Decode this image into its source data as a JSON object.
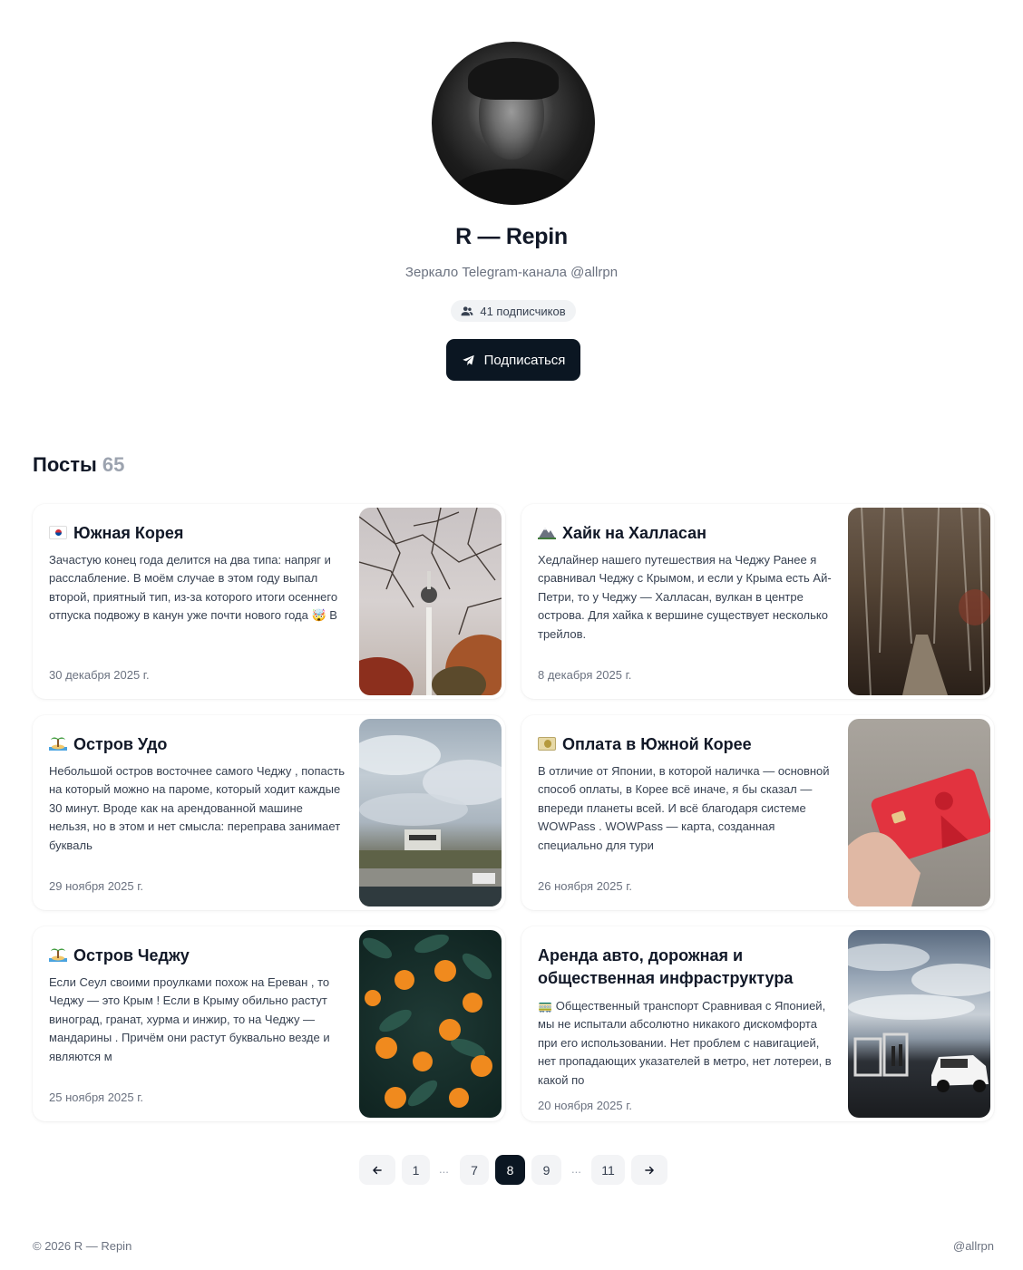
{
  "profile": {
    "name": "R — Repin",
    "subtitle": "Зеркало Telegram-канала @allrpn",
    "subscribers": "41 подписчиков",
    "subscribe_label": "Подписаться"
  },
  "posts_section": {
    "title": "Посты",
    "count": "65"
  },
  "posts": [
    {
      "title": "Южная Корея",
      "icon": "korea-flag-icon",
      "text": "Зачастую конец года делится на два типа: напряг и расслабление. В моём случае в этом году выпал второй, приятный тип, из-за которого итоги осеннего отпуска подвожу в канун уже почти нового года 🤯 В",
      "date": "30 декабря 2025 г."
    },
    {
      "title": "Хайк на Халласан",
      "icon": "mountain-icon",
      "text": "Хедлайнер нашего путешествия на Чеджу Ранее я сравнивал Чеджу с Крымом, и если у Крыма есть Ай-Петри, то у Чеджу — Халласан, вулкан в центре острова. Для хайка к вершине существует несколько трейлов.",
      "date": "8 декабря 2025 г."
    },
    {
      "title": "Остров Удо",
      "icon": "island-icon",
      "text": "Небольшой остров восточнее самого Чеджу , попасть на который можно на пароме, который ходит каждые 30 минут. Вроде как на арендованной машине нельзя, но в этом и нет смысла: переправа занимает буквaль",
      "date": "29 ноября 2025 г."
    },
    {
      "title": "Оплата в Южной Корее",
      "icon": "money-icon",
      "text": "В отличие от Японии, в которой наличка — основной способ оплаты, в Корее всё иначе, я бы сказал — впереди планеты всей. И всё благодаря системе WOWPass . WOWPass — карта, созданная специально для тури",
      "date": "26 ноября 2025 г."
    },
    {
      "title": "Остров Чеджу",
      "icon": "island-icon",
      "text": "Если Сеул своими проулками похож на Ереван , то Чеджу — это Крым ! Если в Крыму обильно растут виноград, гранат, хурма и инжир, то на Чеджу — мандарины . Причём они растут буквально везде и являются м",
      "date": "25 ноября 2025 г."
    },
    {
      "title": "Аренда авто, дорожная и общественная инфраструктура",
      "icon": "",
      "text": "🚃 Общественный транспорт Сравнивая с Японией, мы не испытали абсолютно никакого дискомфорта при его использовании. Нет проблем с навигацией, нет пропадающих указателей в метро, нет лотереи, в какой по",
      "date": "20 ноября 2025 г."
    }
  ],
  "pagination": {
    "first": "1",
    "dots": "...",
    "prev_page": "7",
    "current": "8",
    "next_page": "9",
    "last": "11"
  },
  "footer": {
    "copyright": "© 2026 R — Repin",
    "handle": "@allrpn"
  }
}
